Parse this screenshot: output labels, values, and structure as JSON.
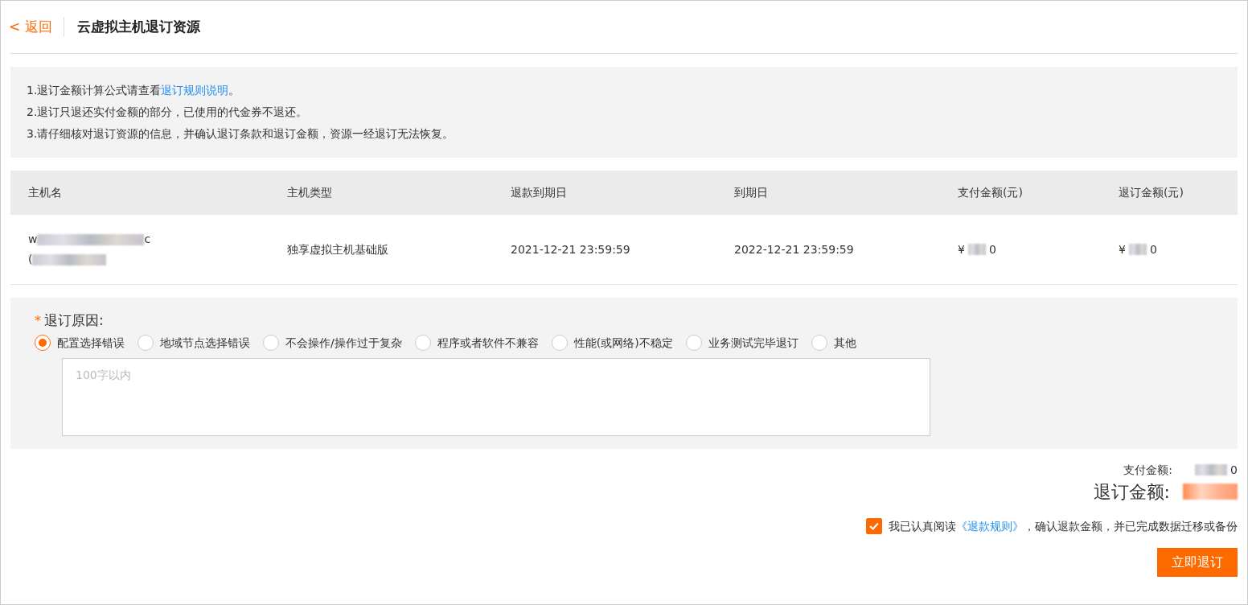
{
  "header": {
    "back": "< 返回",
    "title": "云虚拟主机退订资源"
  },
  "notices": [
    {
      "before": "1.退订金额计算公式请查看",
      "link": "退订规则说明",
      "after": "。"
    },
    {
      "before": "2.退订只退还实付金额的部分，已使用的代金券不退还。"
    },
    {
      "before": "3.请仔细核对退订资源的信息，并确认退订条款和退订金额，资源一经退订无法恢复。"
    }
  ],
  "table": {
    "columns": [
      "主机名",
      "主机类型",
      "退款到期日",
      "到期日",
      "支付金额(元)",
      "退订金额(元)"
    ],
    "rows": [
      {
        "host_name": [
          {
            "prefix": "w",
            "suffix": "c"
          },
          {
            "prefix": "("
          }
        ],
        "type": "独享虚拟主机基础版",
        "refund_date": "2021-12-21 23:59:59",
        "expire_date": "2022-12-21 23:59:59",
        "paid": {
          "prefix": "¥",
          "suffix": "0"
        },
        "refund": {
          "prefix": "¥",
          "suffix": "0"
        }
      }
    ]
  },
  "reason": {
    "required_mark": "*",
    "label": "退订原因:",
    "options": [
      {
        "label": "配置选择错误",
        "selected": true
      },
      {
        "label": "地域节点选择错误",
        "selected": false
      },
      {
        "label": "不会操作/操作过于复杂",
        "selected": false
      },
      {
        "label": "程序或者软件不兼容",
        "selected": false
      },
      {
        "label": "性能(或网络)不稳定",
        "selected": false
      },
      {
        "label": "业务测试完毕退订",
        "selected": false
      },
      {
        "label": "其他",
        "selected": false
      }
    ],
    "placeholder": "100字以内"
  },
  "summary": {
    "paid_label": "支付金额:",
    "paid_suffix": "0",
    "refund_label": "退订金额:"
  },
  "agreement": {
    "checked": true,
    "before": "我已认真阅读",
    "link": "《退款规则》",
    "after": "，确认退款金额，并已完成数据迁移或备份"
  },
  "submit": "立即退订"
}
